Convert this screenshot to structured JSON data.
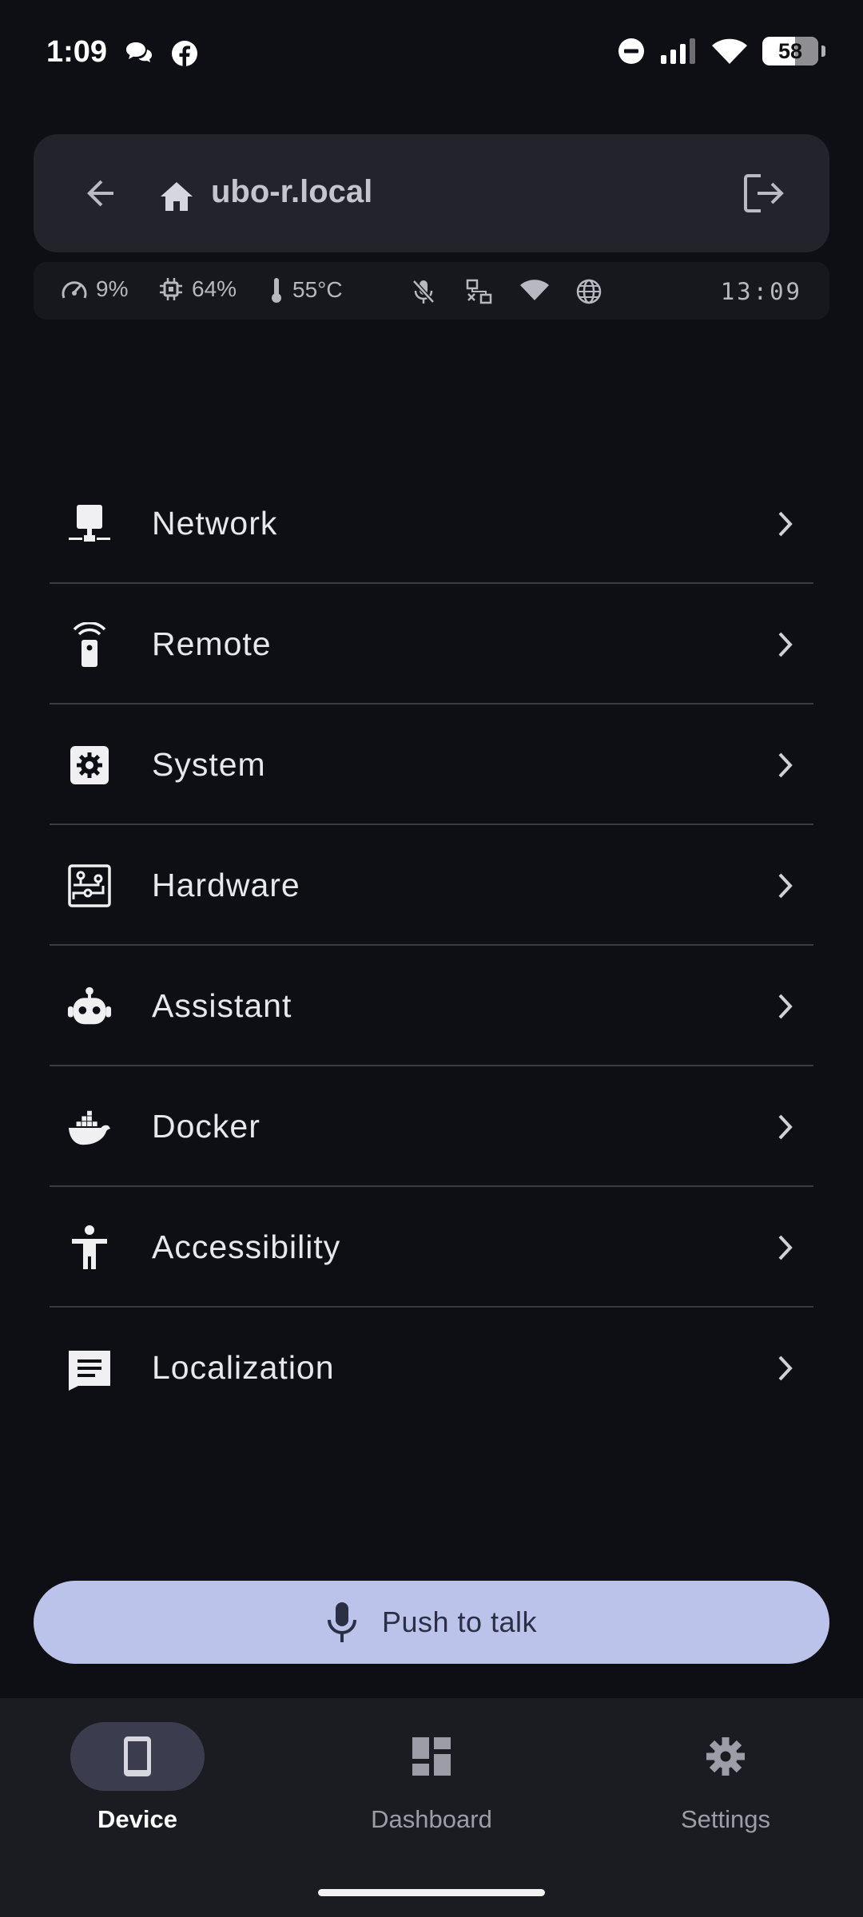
{
  "status_bar": {
    "time": "1:09",
    "battery": "58"
  },
  "header": {
    "title": "ubo-r.local"
  },
  "stats": {
    "cpu": "9%",
    "memory": "64%",
    "temperature": "55°C",
    "clock": "13:09"
  },
  "menu": {
    "items": [
      {
        "label": "Network",
        "icon": "ethernet-icon"
      },
      {
        "label": "Remote",
        "icon": "remote-icon"
      },
      {
        "label": "System",
        "icon": "system-gear-icon"
      },
      {
        "label": "Hardware",
        "icon": "circuit-board-icon"
      },
      {
        "label": "Assistant",
        "icon": "robot-icon"
      },
      {
        "label": "Docker",
        "icon": "docker-whale-icon"
      },
      {
        "label": "Accessibility",
        "icon": "accessibility-person-icon"
      },
      {
        "label": "Localization",
        "icon": "translate-doc-icon"
      }
    ]
  },
  "push_to_talk": {
    "label": "Push to talk"
  },
  "bottom_nav": {
    "items": [
      {
        "label": "Device",
        "active": true
      },
      {
        "label": "Dashboard",
        "active": false
      },
      {
        "label": "Settings",
        "active": false
      }
    ]
  },
  "colors": {
    "background": "#0e0f14",
    "card": "#22232b",
    "accent_button": "#bcc3ea",
    "nav_active_pill": "#3b3d4f"
  }
}
